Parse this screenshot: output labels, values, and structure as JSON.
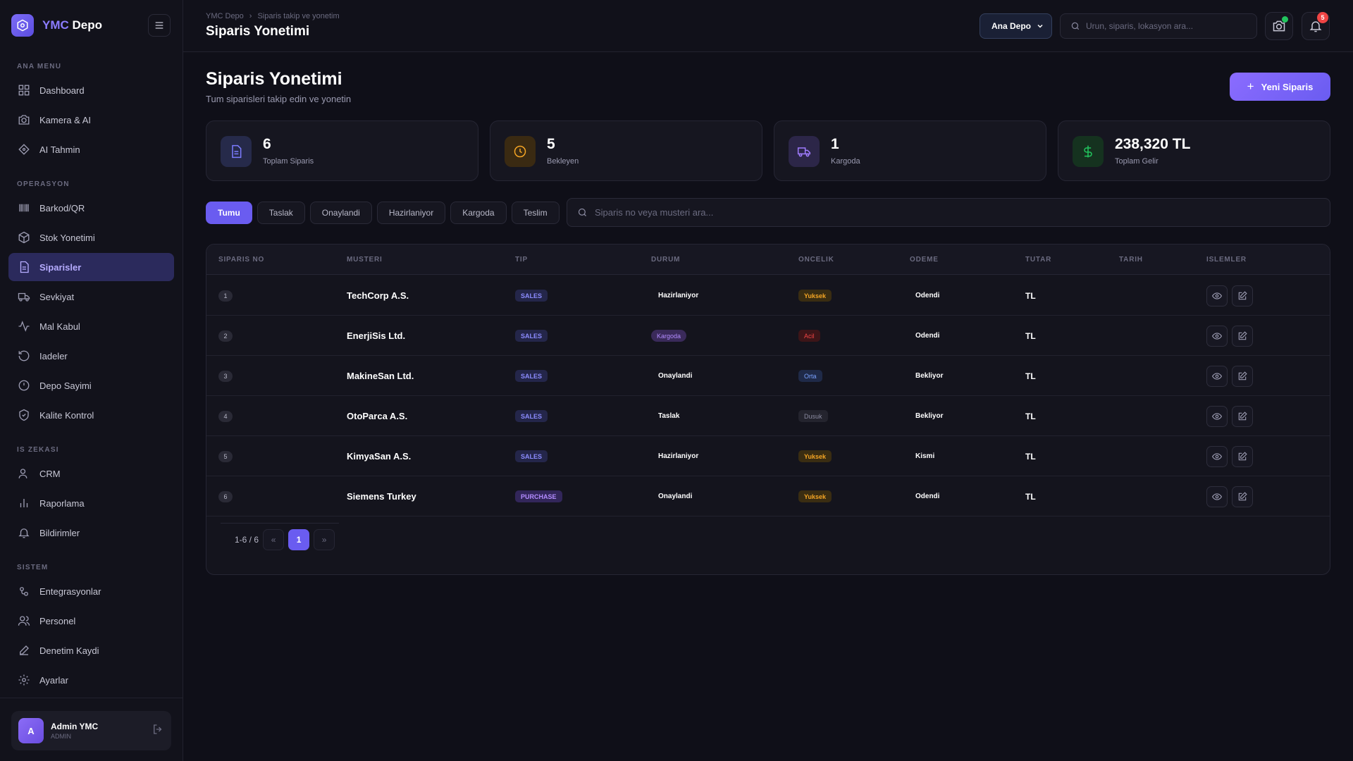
{
  "brand": {
    "prefix": "YMC",
    "suffix": "Depo"
  },
  "sidebar": {
    "sections": [
      {
        "title": "ANA MENU",
        "items": [
          {
            "label": "Dashboard",
            "icon": "dashboard-icon"
          },
          {
            "label": "Kamera & AI",
            "icon": "camera-icon"
          },
          {
            "label": "AI Tahmin",
            "icon": "ai-icon"
          }
        ]
      },
      {
        "title": "OPERASYON",
        "items": [
          {
            "label": "Barkod/QR",
            "icon": "barcode-icon"
          },
          {
            "label": "Stok Yonetimi",
            "icon": "box-icon"
          },
          {
            "label": "Siparisler",
            "icon": "document-icon",
            "active": true
          },
          {
            "label": "Sevkiyat",
            "icon": "truck-icon"
          },
          {
            "label": "Mal Kabul",
            "icon": "activity-icon"
          },
          {
            "label": "Iadeler",
            "icon": "return-icon"
          },
          {
            "label": "Depo Sayimi",
            "icon": "clock-icon"
          },
          {
            "label": "Kalite Kontrol",
            "icon": "shield-icon"
          }
        ]
      },
      {
        "title": "IS ZEKASI",
        "items": [
          {
            "label": "CRM",
            "icon": "user-icon"
          },
          {
            "label": "Raporlama",
            "icon": "bar-chart-icon"
          },
          {
            "label": "Bildirimler",
            "icon": "bell-icon"
          }
        ]
      },
      {
        "title": "SISTEM",
        "items": [
          {
            "label": "Entegrasyonlar",
            "icon": "integration-icon"
          },
          {
            "label": "Personel",
            "icon": "users-icon"
          },
          {
            "label": "Denetim Kaydi",
            "icon": "pen-icon"
          },
          {
            "label": "Ayarlar",
            "icon": "gear-icon"
          }
        ]
      }
    ],
    "user": {
      "initial": "A",
      "name": "Admin YMC",
      "role": "ADMIN"
    }
  },
  "topbar": {
    "breadcrumb": [
      "YMC Depo",
      "Siparis takip ve yonetim"
    ],
    "title": "Siparis Yonetimi",
    "depo_select": "Ana Depo",
    "search_placeholder": "Urun, siparis, lokasyon ara...",
    "notification_count": "5"
  },
  "page": {
    "title": "Siparis Yonetimi",
    "subtitle": "Tum siparisleri takip edin ve yonetin",
    "new_button": "Yeni Siparis"
  },
  "stats": [
    {
      "value": "6",
      "label": "Toplam Siparis",
      "icon": "document-icon",
      "color": "#7c7cff",
      "bg": "#262a4a"
    },
    {
      "value": "5",
      "label": "Bekleyen",
      "icon": "clock-icon",
      "color": "#f5a524",
      "bg": "#3a2a12"
    },
    {
      "value": "1",
      "label": "Kargoda",
      "icon": "truck-icon",
      "color": "#a07cff",
      "bg": "#2c2648"
    },
    {
      "value": "238,320 TL",
      "label": "Toplam Gelir",
      "icon": "dollar-icon",
      "color": "#22c55e",
      "bg": "#15321f"
    }
  ],
  "filters": [
    "Tumu",
    "Taslak",
    "Onaylandi",
    "Hazirlaniyor",
    "Kargoda",
    "Teslim"
  ],
  "order_search_placeholder": "Siparis no veya musteri ara...",
  "table": {
    "columns": [
      "SIPARIS NO",
      "MUSTERI",
      "TIP",
      "DURUM",
      "ONCELIK",
      "ODEME",
      "TUTAR",
      "TARIH",
      "ISLEMLER"
    ],
    "rows": [
      {
        "no": "1",
        "customer": "TechCorp A.S.",
        "type": "SALES",
        "status": "Hazirlaniyor",
        "priority": "Yuksek",
        "payment": "Odendi",
        "amount": "TL"
      },
      {
        "no": "2",
        "customer": "EnerjiSis Ltd.",
        "type": "SALES",
        "status": "Kargoda",
        "priority": "Acil",
        "payment": "Odendi",
        "amount": "TL"
      },
      {
        "no": "3",
        "customer": "MakineSan Ltd.",
        "type": "SALES",
        "status": "Onaylandi",
        "priority": "Orta",
        "payment": "Bekliyor",
        "amount": "TL"
      },
      {
        "no": "4",
        "customer": "OtoParca A.S.",
        "type": "SALES",
        "status": "Taslak",
        "priority": "Dusuk",
        "payment": "Bekliyor",
        "amount": "TL"
      },
      {
        "no": "5",
        "customer": "KimyaSan A.S.",
        "type": "SALES",
        "status": "Hazirlaniyor",
        "priority": "Yuksek",
        "payment": "Kismi",
        "amount": "TL"
      },
      {
        "no": "6",
        "customer": "Siemens Turkey",
        "type": "PURCHASE",
        "status": "Onaylandi",
        "priority": "Yuksek",
        "payment": "Odendi",
        "amount": "TL"
      }
    ]
  },
  "pagination": {
    "info": "1-6 / 6",
    "prev": "«",
    "page": "1",
    "next": "»"
  }
}
